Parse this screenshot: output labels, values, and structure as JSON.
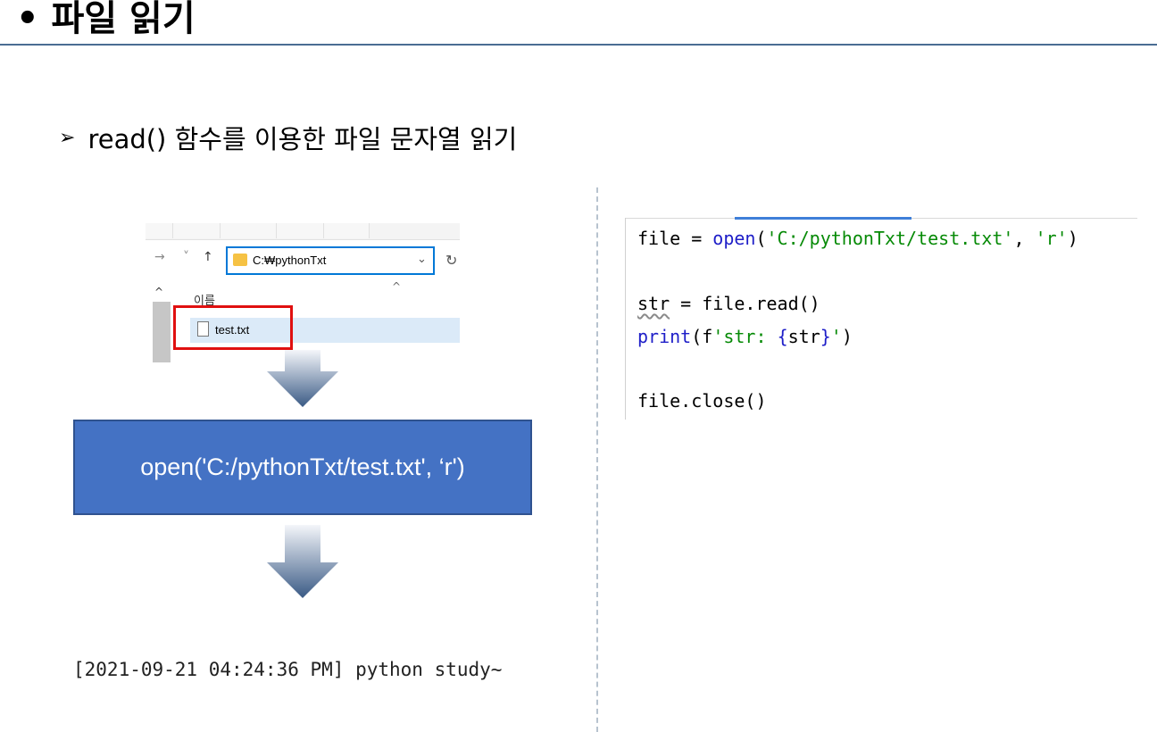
{
  "slide": {
    "title": "• 파일 읽기",
    "subtitle_bullet": "➢",
    "subtitle": "read() 함수를 이용한 파일 문자열 읽기"
  },
  "explorer": {
    "path": "C:₩pythonTxt",
    "column_header": "이름",
    "file_name": "test.txt",
    "nav_back": "→",
    "nav_recent": "˅",
    "nav_up": "↑",
    "dropdown": "⌄",
    "refresh": "↻",
    "scroll_up": "^",
    "sort_caret": "^"
  },
  "flow": {
    "open_call": "open('C:/pythonTxt/test.txt', ‘r')",
    "output": "[2021-09-21 04:24:36 PM] python study~"
  },
  "code": {
    "line1": {
      "var": "file",
      "eq": " = ",
      "fn": "open",
      "lp": "(",
      "arg1": "'C:/pythonTxt/test.txt'",
      "comma": ", ",
      "arg2": "'r'",
      "rp": ")"
    },
    "line2": {
      "var": "str",
      "rest": " = file.read()"
    },
    "line3": {
      "fn": "print",
      "lp": "(f",
      "s1": "'str: ",
      "brace_open": "{",
      "name": "str",
      "brace_close": "}",
      "s2": "'",
      "rp": ")"
    },
    "line4": "file.close()"
  },
  "colors": {
    "title_rule": "#4a6d93",
    "box_fill": "#4472c4",
    "highlight": "#e01010",
    "code_function": "#1e1ec8",
    "code_string": "#068a06"
  }
}
